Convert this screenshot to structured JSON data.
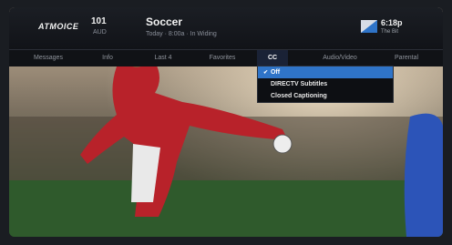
{
  "header": {
    "logo_text": "ATMOICE",
    "channel_number": "101",
    "channel_sub": "AUD",
    "program_title": "Soccer",
    "program_sub": "Today · 8:00a · In Widing",
    "clock": "6:18p",
    "date": "The Bit"
  },
  "tabs": [
    {
      "label": "Messages"
    },
    {
      "label": "Info"
    },
    {
      "label": "Last 4"
    },
    {
      "label": "Favorites"
    },
    {
      "label": "CC"
    },
    {
      "label": "Audio/Video"
    },
    {
      "label": "Parental"
    }
  ],
  "active_tab": "CC",
  "dropdown": {
    "items": [
      {
        "label": "Off",
        "selected": true
      },
      {
        "label": "DIRECTV Subtitles",
        "selected": false
      },
      {
        "label": "Closed Captioning",
        "selected": false
      }
    ]
  },
  "colors": {
    "accent": "#2f74c8",
    "bar": "#111318"
  }
}
